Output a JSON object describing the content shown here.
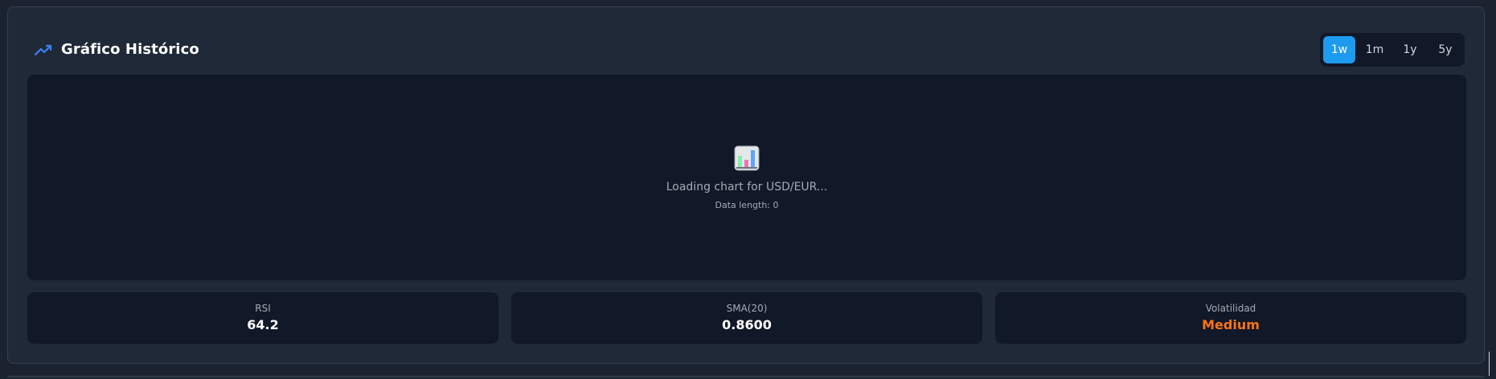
{
  "header": {
    "title": "Gráfico Histórico",
    "icon": "trending-up-icon",
    "accent_color": "#3b82f6"
  },
  "tabs": [
    {
      "label": "1w",
      "active": true
    },
    {
      "label": "1m",
      "active": false
    },
    {
      "label": "1y",
      "active": false
    },
    {
      "label": "5y",
      "active": false
    }
  ],
  "chart": {
    "icon": "bar-chart-icon",
    "loading_text": "Loading chart for USD/EUR...",
    "data_length_text": "Data length: 0"
  },
  "stats": [
    {
      "label": "RSI",
      "value": "64.2",
      "color": "#ffffff"
    },
    {
      "label": "SMA(20)",
      "value": "0.8600",
      "color": "#ffffff"
    },
    {
      "label": "Volatilidad",
      "value": "Medium",
      "color": "#f97316"
    }
  ]
}
